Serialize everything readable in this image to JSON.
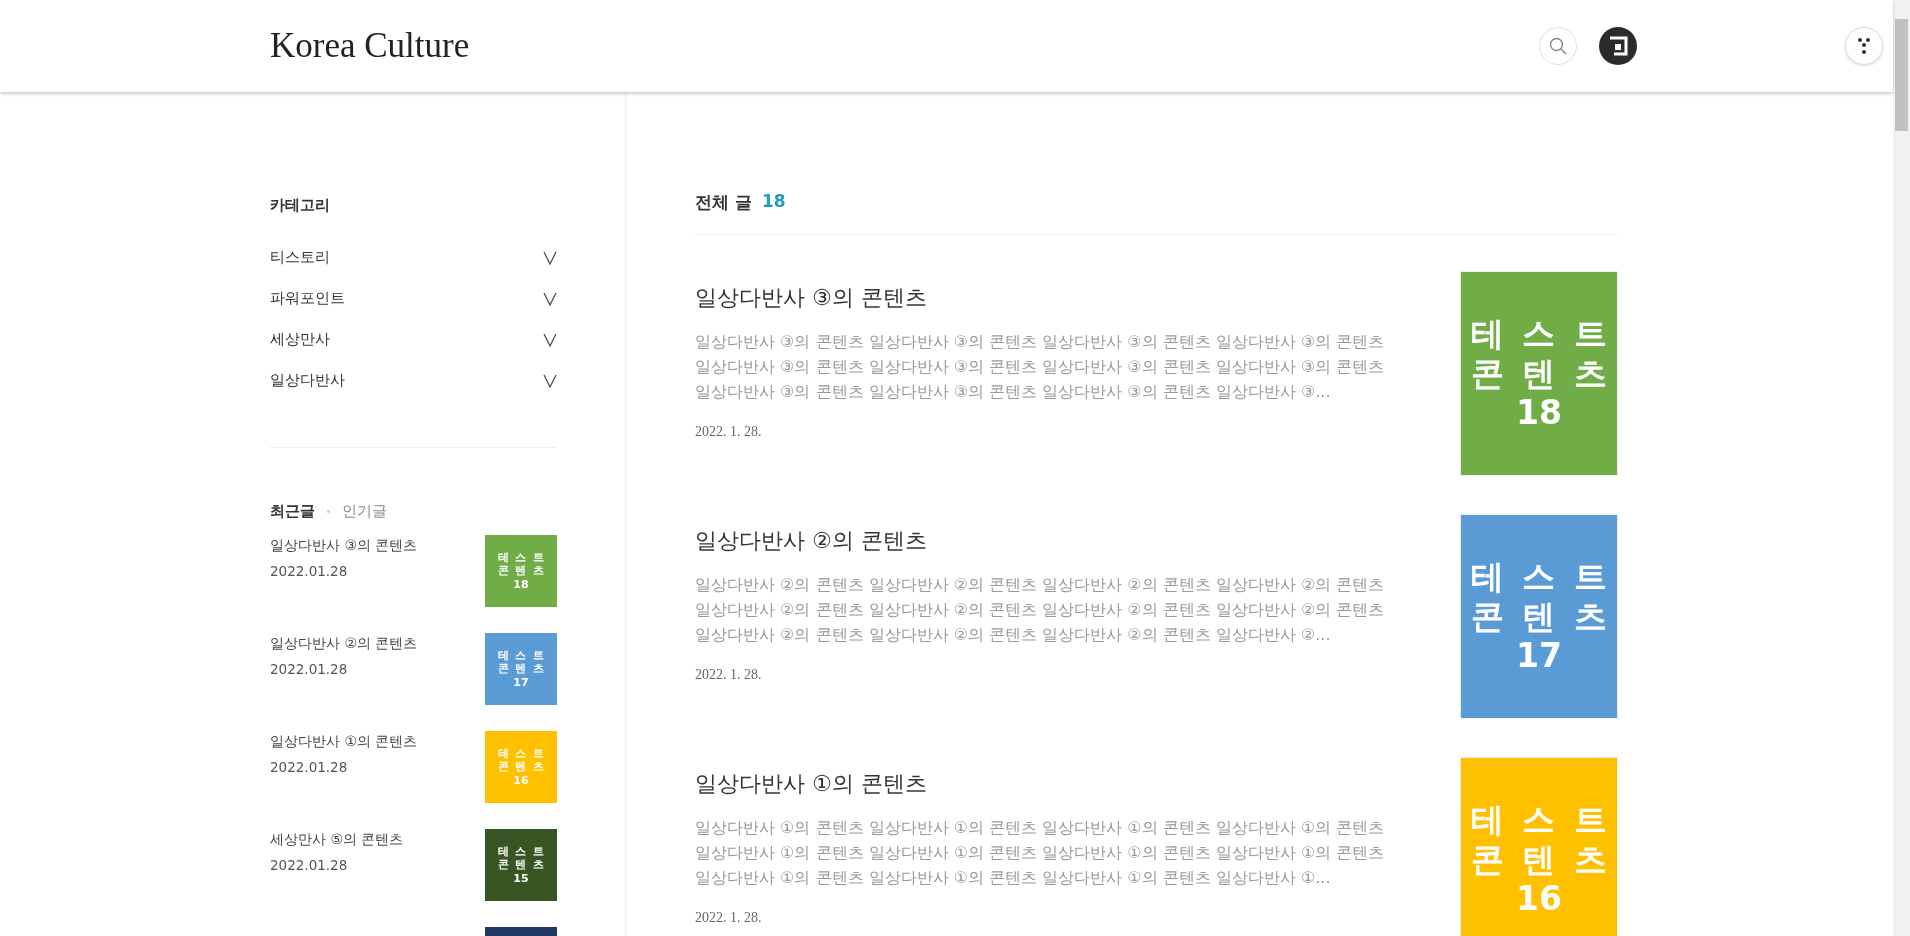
{
  "header": {
    "logo": "Korea Culture"
  },
  "sidebar": {
    "category_title": "카테고리",
    "categories": [
      {
        "label": "티스토리",
        "expanded": false
      },
      {
        "label": "파워포인트",
        "expanded": false
      },
      {
        "label": "세상만사",
        "expanded": false
      },
      {
        "label": "일상다반사",
        "expanded": false
      }
    ],
    "tabs": [
      {
        "label": "최근글",
        "selected": true
      },
      {
        "label": "인기글",
        "selected": false
      }
    ],
    "recent": [
      {
        "title": "일상다반사 ③의 콘텐츠",
        "date": "2022.01.28",
        "thumb": {
          "lines": [
            "테스트",
            "콘텐츠",
            "18"
          ],
          "color": "#70ad47"
        }
      },
      {
        "title": "일상다반사 ②의 콘텐츠",
        "date": "2022.01.28",
        "thumb": {
          "lines": [
            "테스트",
            "콘텐츠",
            "17"
          ],
          "color": "#5b9bd5"
        }
      },
      {
        "title": "일상다반사 ①의 콘텐츠",
        "date": "2022.01.28",
        "thumb": {
          "lines": [
            "테스트",
            "콘텐츠",
            "16"
          ],
          "color": "#ffc000"
        }
      },
      {
        "title": "세상만사 ⑤의 콘텐츠",
        "date": "2022.01.28",
        "thumb": {
          "lines": [
            "테스트",
            "콘텐츠",
            "15"
          ],
          "color": "#375623"
        }
      },
      {
        "thumb": {
          "color": "#1f3864"
        }
      }
    ]
  },
  "main": {
    "heading": "전체 글",
    "count": "18",
    "posts": [
      {
        "title": "일상다반사 ③의 콘텐츠",
        "excerpt": "일상다반사 ③의 콘텐츠 일상다반사 ③의 콘텐츠 일상다반사 ③의 콘텐츠 일상다반사 ③의 콘텐츠 일상다반사 ③의 콘텐츠 일상다반사 ③의 콘텐츠 일상다반사 ③의 콘텐츠 일상다반사 ③의 콘텐츠 일상다반사 ③의 콘텐츠 일상다반사 ③의 콘텐츠 일상다반사 ③의 콘텐츠 일상다반사 ③...",
        "date": "2022. 1. 28.",
        "thumb": {
          "lines": [
            "테스트",
            "콘텐츠",
            "18"
          ],
          "color": "#70ad47"
        }
      },
      {
        "title": "일상다반사 ②의 콘텐츠",
        "excerpt": "일상다반사 ②의 콘텐츠 일상다반사 ②의 콘텐츠 일상다반사 ②의 콘텐츠 일상다반사 ②의 콘텐츠 일상다반사 ②의 콘텐츠 일상다반사 ②의 콘텐츠 일상다반사 ②의 콘텐츠 일상다반사 ②의 콘텐츠 일상다반사 ②의 콘텐츠 일상다반사 ②의 콘텐츠 일상다반사 ②의 콘텐츠 일상다반사 ②...",
        "date": "2022. 1. 28.",
        "thumb": {
          "lines": [
            "테스트",
            "콘텐츠",
            "17"
          ],
          "color": "#5b9bd5"
        }
      },
      {
        "title": "일상다반사 ①의 콘텐츠",
        "excerpt": "일상다반사 ①의 콘텐츠 일상다반사 ①의 콘텐츠 일상다반사 ①의 콘텐츠 일상다반사 ①의 콘텐츠 일상다반사 ①의 콘텐츠 일상다반사 ①의 콘텐츠 일상다반사 ①의 콘텐츠 일상다반사 ①의 콘텐츠 일상다반사 ①의 콘텐츠 일상다반사 ①의 콘텐츠 일상다반사 ①의 콘텐츠 일상다반사 ①...",
        "date": "2022. 1. 28.",
        "thumb": {
          "lines": [
            "테스트",
            "콘텐츠",
            "16"
          ],
          "color": "#ffc000"
        }
      }
    ]
  }
}
